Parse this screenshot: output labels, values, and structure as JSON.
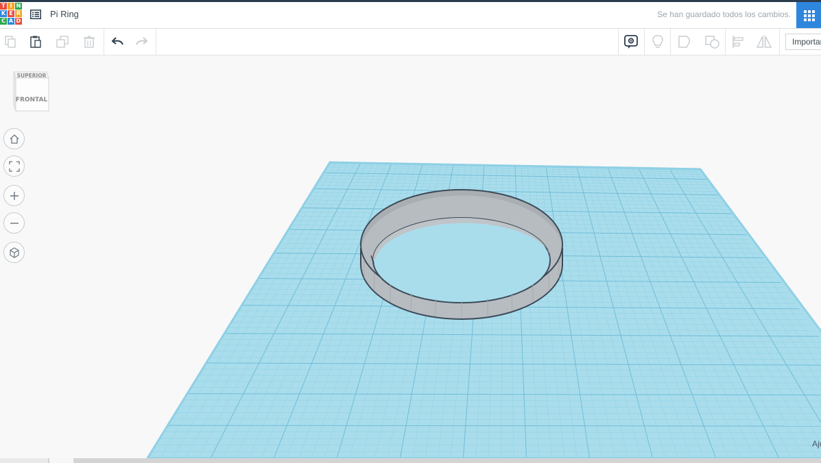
{
  "header": {
    "logo_letters": [
      "T",
      "I",
      "N",
      "K",
      "E",
      "R",
      "C",
      "A",
      "D"
    ],
    "design_title": "Pi Ring",
    "save_status": "Se han guardado todos los cambios."
  },
  "toolbar": {
    "import_label": "Importar"
  },
  "viewcube": {
    "top_face": "SUPERIOR",
    "front_face": "FRONTAL"
  },
  "footer": {
    "snap_label": "Ajustar rejilla"
  },
  "colors": {
    "workplane": "#a8dcec",
    "grid_line": "#7cc3dc",
    "ring": "#b4b9bd",
    "accent": "#2f86dd"
  }
}
